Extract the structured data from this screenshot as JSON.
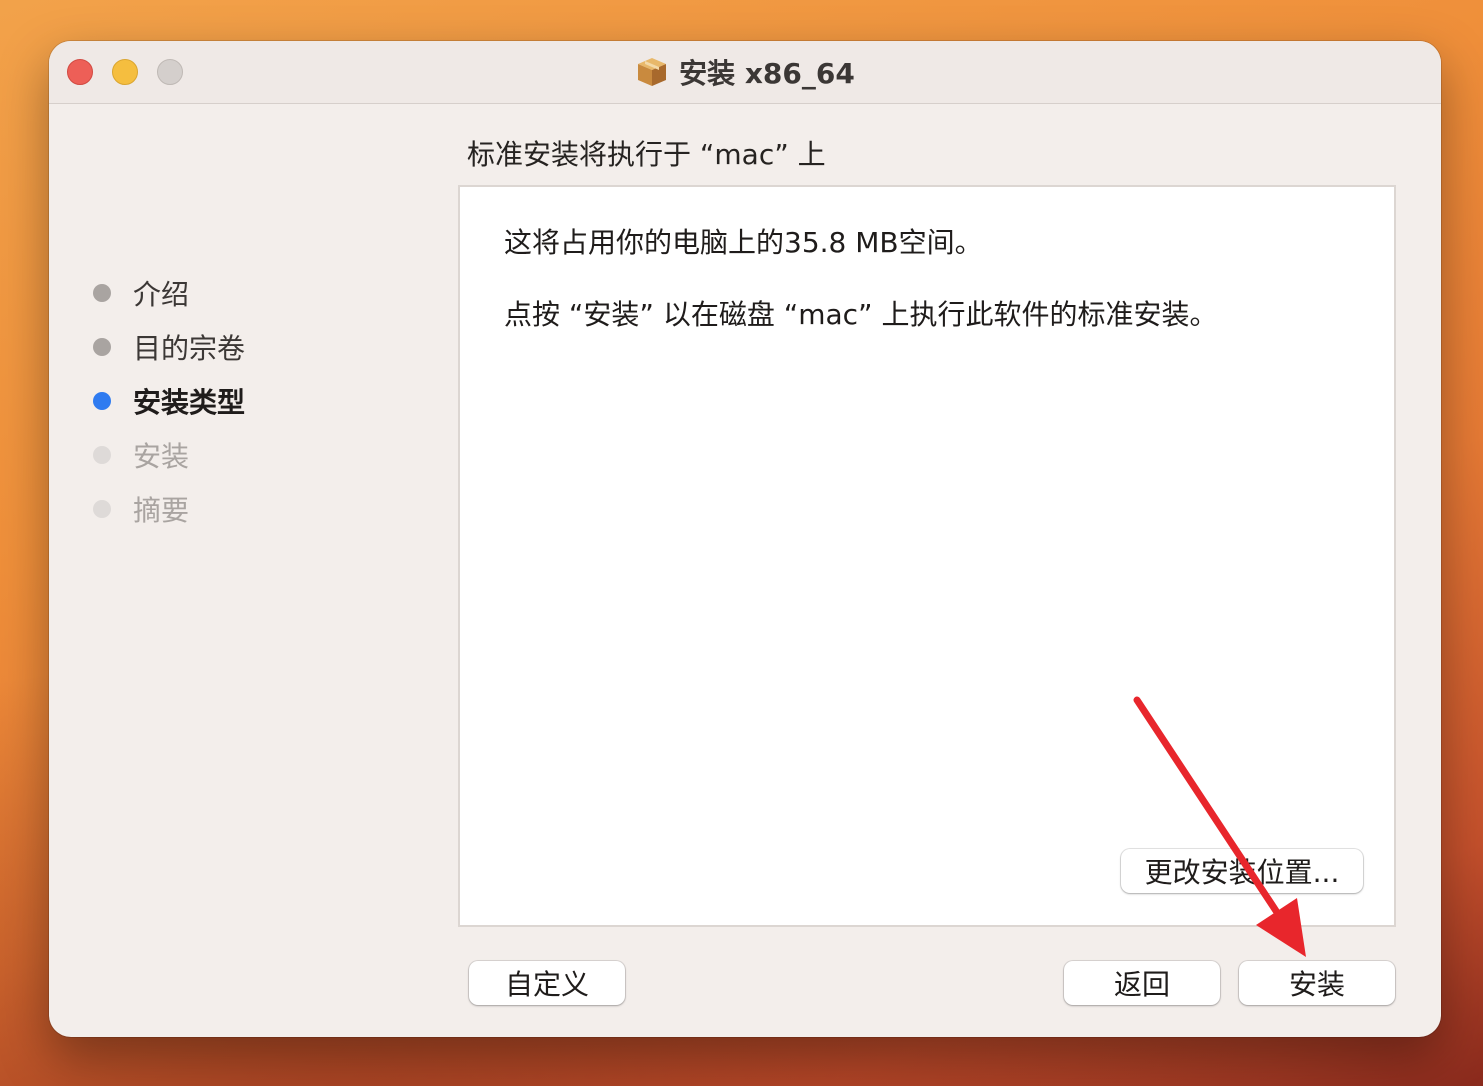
{
  "window": {
    "title": "安装 x86_64"
  },
  "sidebar": {
    "steps": [
      {
        "label": "介绍",
        "state": "done"
      },
      {
        "label": "目的宗卷",
        "state": "done"
      },
      {
        "label": "安装类型",
        "state": "active"
      },
      {
        "label": "安装",
        "state": "pending"
      },
      {
        "label": "摘要",
        "state": "pending"
      }
    ]
  },
  "main": {
    "heading": "标准安装将执行于 “mac” 上",
    "line1": "这将占用你的电脑上的35.8 MB空间。",
    "line2": "点按 “安装” 以在磁盘 “mac” 上执行此软件的标准安装。",
    "change_location_label": "更改安装位置..."
  },
  "footer": {
    "customize_label": "自定义",
    "back_label": "返回",
    "install_label": "安装"
  },
  "colors": {
    "active_step": "#2f7bf0",
    "annotation_arrow": "#e8262c"
  }
}
